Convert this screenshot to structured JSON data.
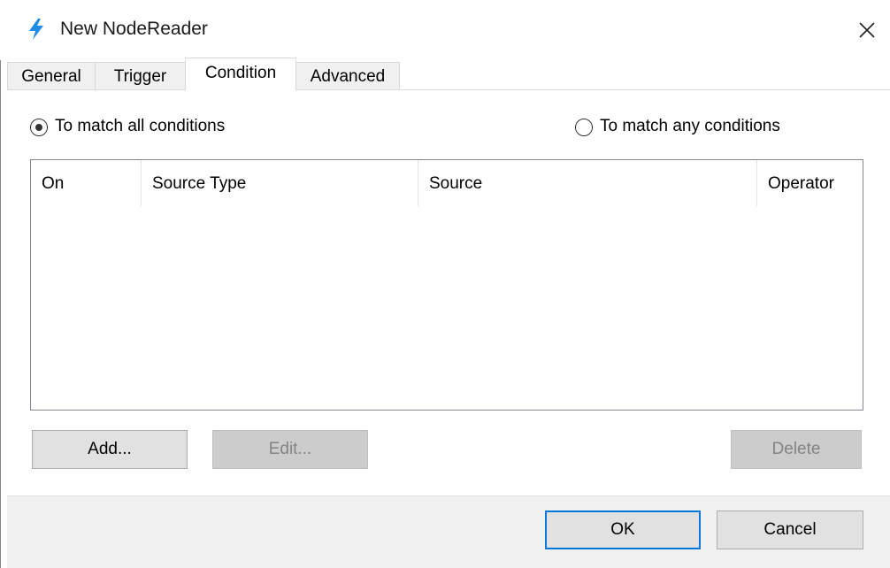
{
  "window": {
    "title": "New NodeReader",
    "accent_color": "#0078d7",
    "icon": "lightning-icon",
    "close_icon": "close-icon"
  },
  "tabs": [
    {
      "label": "General",
      "active": false
    },
    {
      "label": "Trigger",
      "active": false
    },
    {
      "label": "Condition",
      "active": true
    },
    {
      "label": "Advanced",
      "active": false
    }
  ],
  "condition": {
    "match_all_label": "To match all conditions",
    "match_any_label": "To match any conditions",
    "selected": "match_all",
    "table": {
      "columns": [
        "On",
        "Source Type",
        "Source",
        "Operator"
      ],
      "rows": []
    },
    "buttons": {
      "add": {
        "label": "Add...",
        "enabled": true
      },
      "edit": {
        "label": "Edit...",
        "enabled": false
      },
      "delete": {
        "label": "Delete",
        "enabled": false
      }
    }
  },
  "footer": {
    "ok_label": "OK",
    "cancel_label": "Cancel"
  }
}
